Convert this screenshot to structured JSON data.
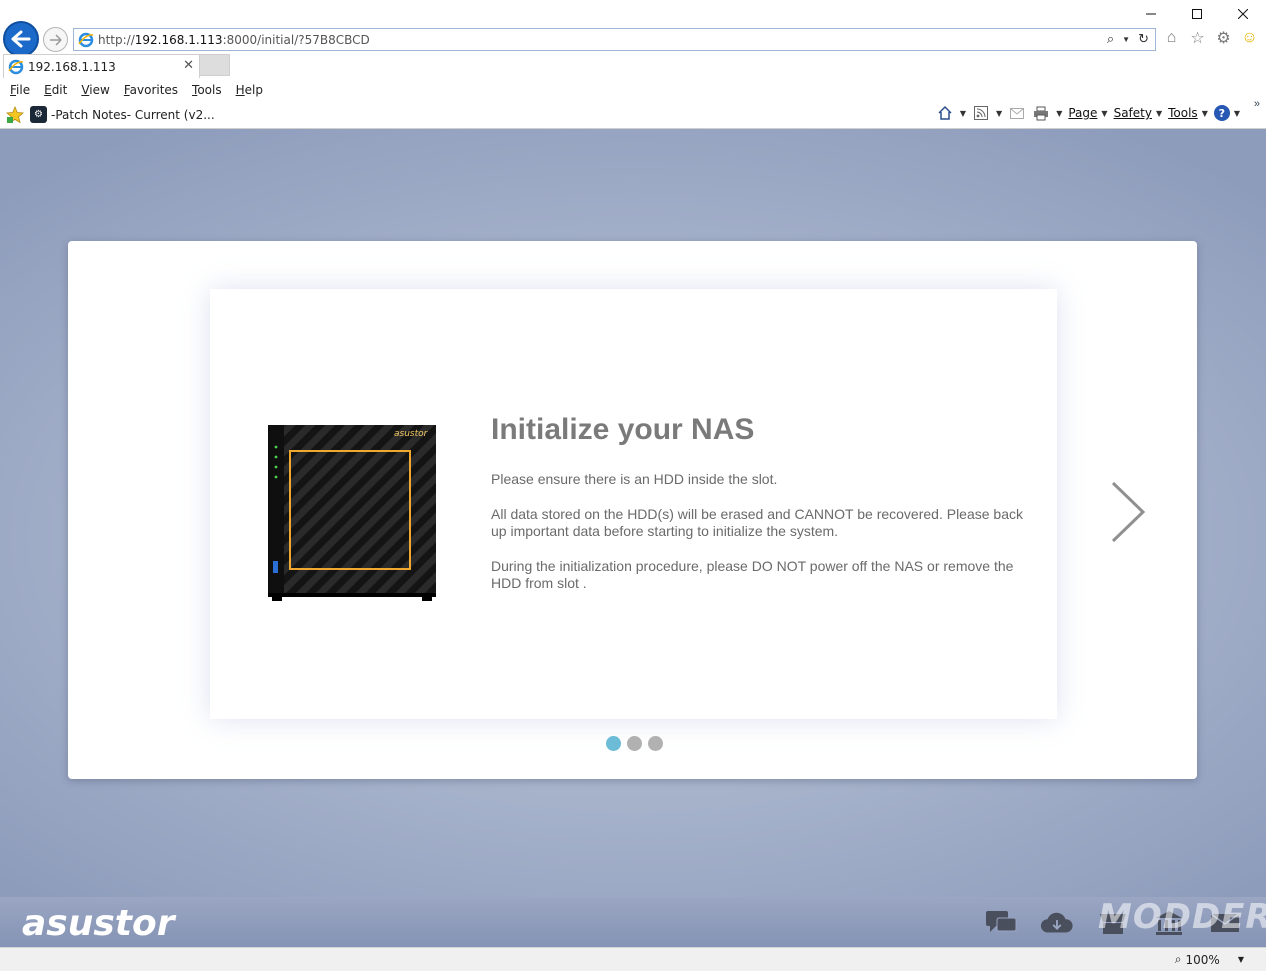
{
  "browser": {
    "url_prefix": "http://",
    "url_host": "192.168.1.113",
    "url_path": ":8000/initial/?57B8CBCD",
    "tab_title": "192.168.1.113",
    "menu": [
      "File",
      "Edit",
      "View",
      "Favorites",
      "Tools",
      "Help"
    ],
    "favorite_item": "-Patch Notes- Current (v2...",
    "commands": {
      "page": "Page",
      "safety": "Safety",
      "tools": "Tools"
    },
    "zoom": "100%"
  },
  "slide": {
    "title": "Initialize your NAS",
    "p1": "Please ensure there is an HDD inside the slot.",
    "p2": "All data stored on the HDD(s) will be erased and CANNOT be recovered. Please back up important data before starting to initialize the system.",
    "p3": "During the initialization procedure, please DO NOT power off the NAS or remove the HDD from slot .",
    "device_brand": "asustor",
    "current_page": 1,
    "total_pages": 3
  },
  "footer": {
    "brand": "asustor",
    "watermark": "MODDERS"
  },
  "colors": {
    "accent_dot": "#6cbcd8",
    "inactive_dot": "#b1b1b1",
    "device_frame": "#f0a830"
  }
}
